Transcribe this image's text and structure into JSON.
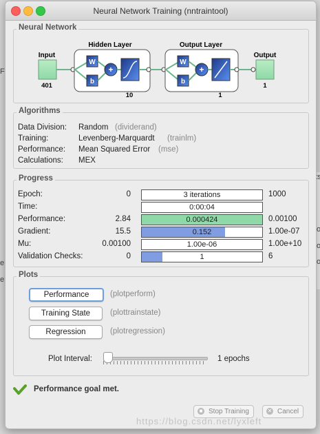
{
  "window": {
    "title": "Neural Network Training (nntraintool)"
  },
  "network": {
    "panel_title": "Neural Network",
    "input": {
      "label": "Input",
      "size": "401"
    },
    "hidden": {
      "label": "Hidden Layer",
      "size": "10",
      "w": "W",
      "b": "b"
    },
    "output_layer": {
      "label": "Output Layer",
      "size": "1",
      "w": "W",
      "b": "b"
    },
    "output": {
      "label": "Output",
      "size": "1"
    }
  },
  "algorithms": {
    "panel_title": "Algorithms",
    "rows": [
      {
        "label": "Data Division:",
        "value": "Random",
        "detail": "(dividerand)"
      },
      {
        "label": "Training:",
        "value": "Levenberg-Marquardt",
        "detail": "(trainlm)"
      },
      {
        "label": "Performance:",
        "value": "Mean Squared Error",
        "detail": "(mse)"
      },
      {
        "label": "Calculations:",
        "value": "MEX",
        "detail": ""
      }
    ]
  },
  "progress": {
    "panel_title": "Progress",
    "rows": [
      {
        "label": "Epoch:",
        "start": "0",
        "current": "3 iterations",
        "end": "1000",
        "fill": 0,
        "color": "#ffffff"
      },
      {
        "label": "Time:",
        "start": "",
        "current": "0:00:04",
        "end": "",
        "fill": 0,
        "color": "#ffffff"
      },
      {
        "label": "Performance:",
        "start": "2.84",
        "current": "0.000424",
        "end": "0.00100",
        "fill": 1.0,
        "color": "#8fd9a8"
      },
      {
        "label": "Gradient:",
        "start": "15.5",
        "current": "0.152",
        "end": "1.00e-07",
        "fill": 0.69,
        "color": "#7f9de0"
      },
      {
        "label": "Mu:",
        "start": "0.00100",
        "current": "1.00e-06",
        "end": "1.00e+10",
        "fill": 0,
        "color": "#ffffff"
      },
      {
        "label": "Validation Checks:",
        "start": "0",
        "current": "1",
        "end": "6",
        "fill": 0.17,
        "color": "#7f9de0"
      }
    ]
  },
  "plots": {
    "panel_title": "Plots",
    "buttons": [
      {
        "label": "Performance",
        "fn": "(plotperform)"
      },
      {
        "label": "Training State",
        "fn": "(plottrainstate)"
      },
      {
        "label": "Regression",
        "fn": "(plotregression)"
      }
    ],
    "interval_label": "Plot Interval:",
    "interval_value": "1 epochs",
    "interval_level": 0.0
  },
  "status": {
    "text": "Performance goal met."
  },
  "actions": {
    "stop": "Stop Training",
    "cancel": "Cancel"
  },
  "background": {
    "right_fragments": [
      "hts",
      "wo",
      "wo",
      "wo"
    ],
    "left_fragments": [
      "F",
      "e",
      "e"
    ]
  },
  "watermark": "https://blog.csdn.net/lyxleft"
}
